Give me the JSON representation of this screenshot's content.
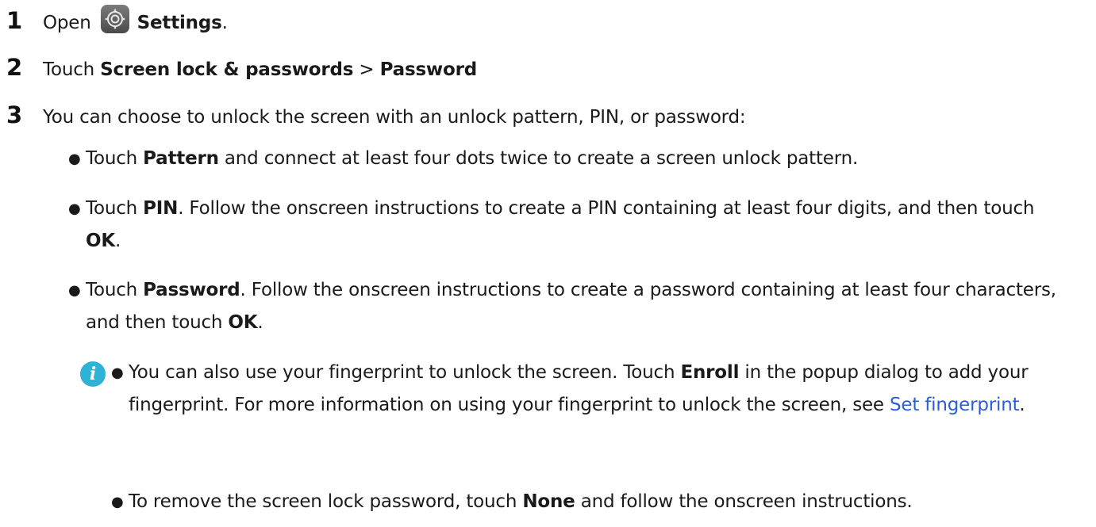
{
  "steps": [
    {
      "num": "1",
      "pre": "Open",
      "bold": "Settings",
      "post": "."
    },
    {
      "num": "2",
      "pre": "Touch",
      "bold1": "Screen lock & passwords",
      "sep": ">",
      "bold2": "Password"
    },
    {
      "num": "3",
      "text": "You can choose to unlock the screen with an unlock pattern, PIN, or password:"
    }
  ],
  "bullets": [
    {
      "pre": "Touch ",
      "bold": "Pattern",
      "post": " and connect at least four dots twice to create a screen unlock pattern."
    },
    {
      "pre": "Touch ",
      "bold": "PIN",
      "mid": ". Follow the onscreen instructions to create a PIN containing at least four digits, and then touch ",
      "bold2": "OK",
      "post": "."
    },
    {
      "pre": "Touch ",
      "bold": "Password",
      "mid": ". Follow the onscreen instructions to create a password containing at least four characters, and then touch ",
      "bold2": "OK",
      "post": "."
    }
  ],
  "note": {
    "icon_letter": "i",
    "items": [
      {
        "pre": "You can also use your fingerprint to unlock the screen. Touch ",
        "bold": "Enroll",
        "mid": " in the popup dialog to add your fingerprint. For more information on using your fingerprint to unlock the screen, see ",
        "link": "Set fingerprint",
        "post": "."
      },
      {
        "pre": "To remove the screen lock password, touch ",
        "bold": "None",
        "post": " and follow the onscreen instructions."
      }
    ]
  },
  "colors": {
    "text": "#1a1a1a",
    "link": "#2a5fdc",
    "note_icon": "#2eb3d6"
  },
  "icons": {
    "settings": "settings-gear-icon",
    "note": "info-icon"
  }
}
